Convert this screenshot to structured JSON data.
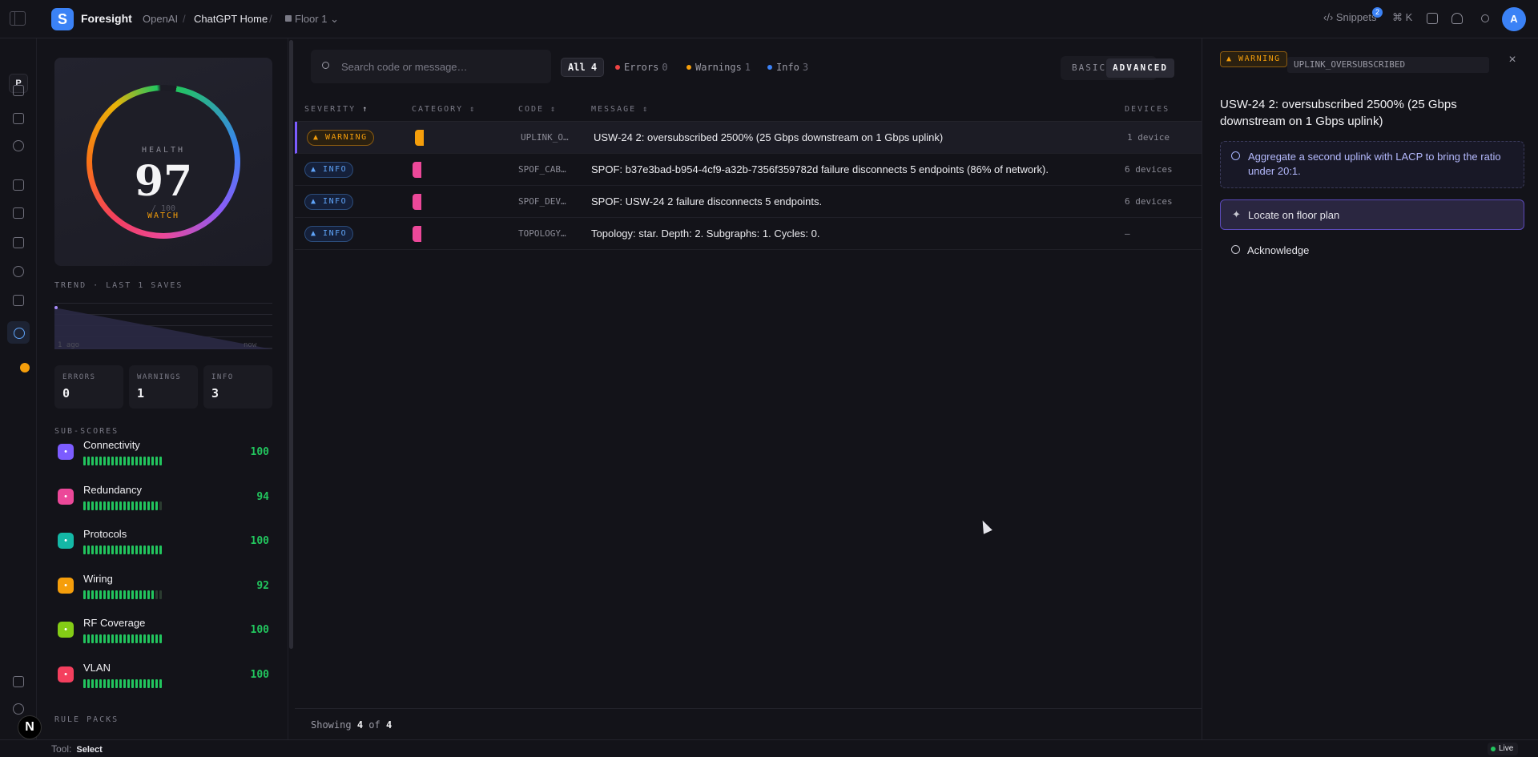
{
  "app": {
    "logo_letter": "S",
    "brand": "Foresight"
  },
  "breadcrumb": {
    "org": "OpenAI",
    "project": "ChatGPT Home",
    "floor": "Floor 1"
  },
  "topbar": {
    "snippets_label": "Snippets",
    "snippets_count": "2",
    "shortcut": "⌘ K",
    "user_initial": "A"
  },
  "rail": {
    "project_initial": "P",
    "workspace_initial": "N"
  },
  "health": {
    "label": "HEALTH",
    "value": "97",
    "max": "/ 100",
    "status": "WATCH",
    "trend_label": "TREND · LAST 1 SAVES",
    "trend_start": "1 ago",
    "trend_end": "now",
    "counts": [
      {
        "label": "ERRORS",
        "value": "0"
      },
      {
        "label": "WARNINGS",
        "value": "1"
      },
      {
        "label": "INFO",
        "value": "3"
      }
    ]
  },
  "subscores": {
    "label": "SUB-SCORES",
    "items": [
      {
        "name": "Connectivity",
        "score": "100",
        "icon": "bolt-icon",
        "color": "#7c5cff",
        "fill": 1.0
      },
      {
        "name": "Redundancy",
        "score": "94",
        "icon": "shield-icon",
        "color": "#ec4899",
        "fill": 0.94
      },
      {
        "name": "Protocols",
        "score": "100",
        "icon": "layers-icon",
        "color": "#14b8a6",
        "fill": 1.0
      },
      {
        "name": "Wiring",
        "score": "92",
        "icon": "cable-icon",
        "color": "#f59e0b",
        "fill": 0.92
      },
      {
        "name": "RF Coverage",
        "score": "100",
        "icon": "wifi-icon",
        "color": "#84cc16",
        "fill": 1.0
      },
      {
        "name": "VLAN",
        "score": "100",
        "icon": "network-icon",
        "color": "#f43f5e",
        "fill": 1.0
      }
    ],
    "rule_packs_label": "RULE PACKS"
  },
  "issues": {
    "search_placeholder": "Search code or message…",
    "filters": {
      "all": {
        "label": "All",
        "count": "4"
      },
      "errors": {
        "label": "Errors",
        "count": "0",
        "color": "#ef4444"
      },
      "warnings": {
        "label": "Warnings",
        "count": "1",
        "color": "#f59e0b"
      },
      "info": {
        "label": "Info",
        "count": "3",
        "color": "#3b82f6"
      }
    },
    "modes": {
      "basic": "BASIC",
      "advanced": "ADVANCED"
    },
    "columns": {
      "severity": "SEVERITY",
      "category": "CATEGORY",
      "code": "CODE",
      "message": "MESSAGE",
      "devices": "DEVICES"
    },
    "rows": [
      {
        "severity": "WARNING",
        "code": "UPLINK_O…",
        "message": "USW-24 2: oversubscribed 2500% (25 Gbps downstream on 1 Gbps uplink)",
        "devices": "1 device",
        "cat_color": "#f59e0b"
      },
      {
        "severity": "INFO",
        "code": "SPOF_CAB…",
        "message": "SPOF: b37e3bad-b954-4cf9-a32b-7356f359782d failure disconnects 5 endpoints (86% of network).",
        "devices": "6 devices",
        "cat_color": "#ec4899"
      },
      {
        "severity": "INFO",
        "code": "SPOF_DEV…",
        "message": "SPOF: USW-24 2 failure disconnects 5 endpoints.",
        "devices": "6 devices",
        "cat_color": "#ec4899"
      },
      {
        "severity": "INFO",
        "code": "TOPOLOGY…",
        "message": "Topology: star. Depth: 2. Subgraphs: 1. Cycles: 0.",
        "devices": "—",
        "cat_color": "#ec4899"
      }
    ],
    "footer": {
      "prefix": "Showing",
      "shown": "4",
      "of": "of",
      "total": "4"
    }
  },
  "detail": {
    "severity": "WARNING",
    "code": "UPLINK_OVERSUBSCRIBED",
    "title": "USW-24 2: oversubscribed 2500% (25 Gbps downstream on 1 Gbps uplink)",
    "hint": "Aggregate a second uplink with LACP to bring the ratio under 20:1.",
    "action_locate": "Locate on floor plan",
    "action_ack": "Acknowledge"
  },
  "statusbar": {
    "tool_label": "Tool:",
    "tool_value": "Select",
    "live_label": "Live"
  }
}
